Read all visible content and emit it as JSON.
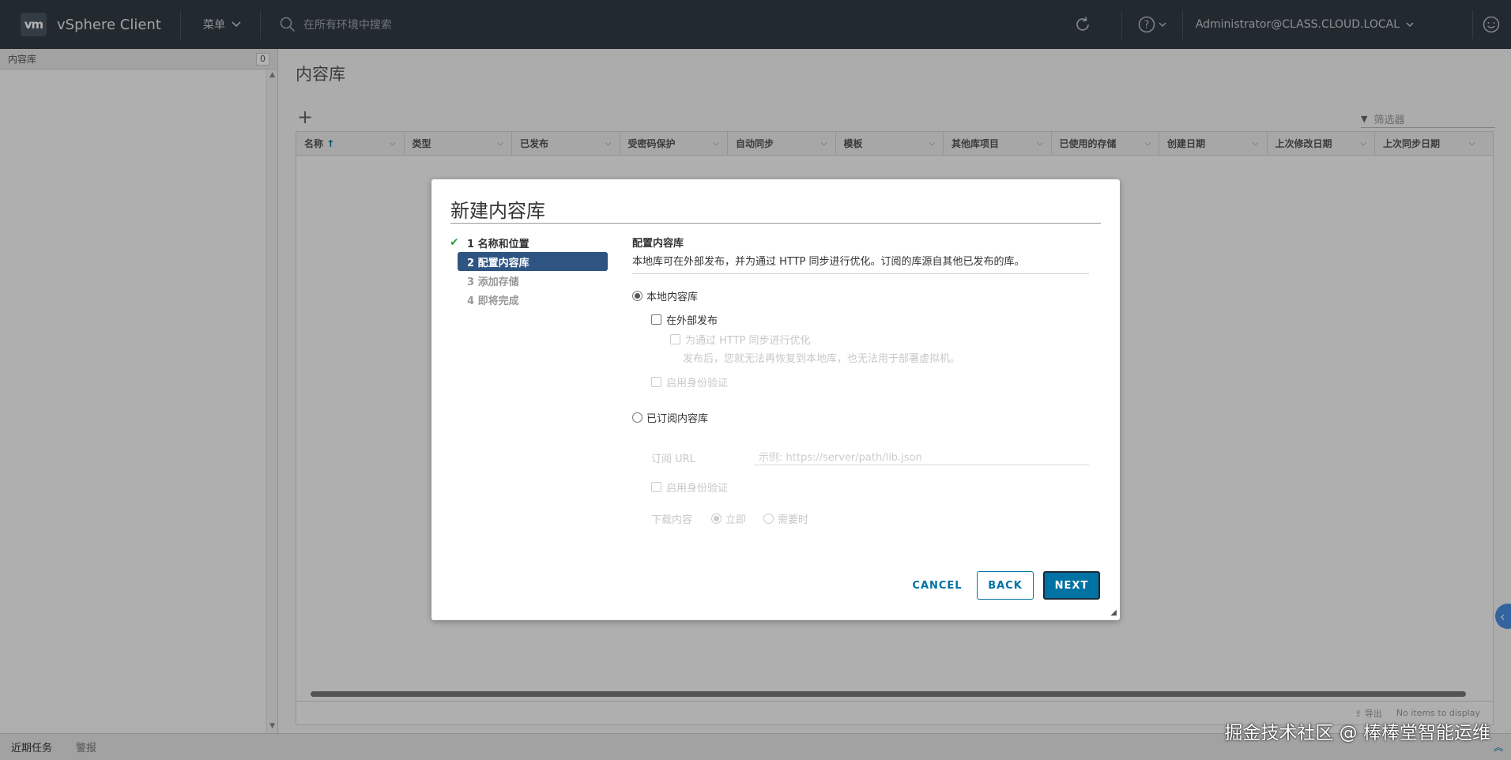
{
  "header": {
    "logo": "vm",
    "app_title": "vSphere Client",
    "menu_label": "菜单",
    "search_placeholder": "在所有环境中搜索",
    "user": "Administrator@CLASS.CLOUD.LOCAL",
    "icons": [
      "refresh-icon",
      "help-icon",
      "smiley-icon"
    ]
  },
  "left_pane": {
    "title": "内容库",
    "count": "0"
  },
  "main": {
    "title": "内容库",
    "add_label": "+",
    "filter_placeholder": "筛选器",
    "columns": [
      "名称",
      "类型",
      "已发布",
      "受密码保护",
      "自动同步",
      "模板",
      "其他库项目",
      "已使用的存储",
      "创建日期",
      "上次修改日期",
      "上次同步日期"
    ],
    "sort_indicator": "↑",
    "export_label": "导出",
    "empty_text": "No items to display"
  },
  "bottom": {
    "tab_recent": "近期任务",
    "tab_alarms": "警报"
  },
  "watermark": "掘金技术社区 @ 棒棒堂智能运维",
  "dialog": {
    "title": "新建内容库",
    "steps": [
      {
        "label": "1 名称和位置",
        "state": "done"
      },
      {
        "label": "2 配置内容库",
        "state": "active"
      },
      {
        "label": "3 添加存储",
        "state": "pending"
      },
      {
        "label": "4 即将完成",
        "state": "pending"
      }
    ],
    "section_title": "配置内容库",
    "section_desc": "本地库可在外部发布，并为通过 HTTP 同步进行优化。订阅的库源自其他已发布的库。",
    "local_library": "本地内容库",
    "publish_external": "在外部发布",
    "optimize_http": "为通过 HTTP 同步进行优化",
    "optimize_note": "发布后，您就无法再恢复到本地库，也无法用于部署虚拟机。",
    "enable_auth": "启用身份验证",
    "subscribed_library": "已订阅内容库",
    "subscription_url_label": "订阅 URL",
    "subscription_url_placeholder": "示例: https://server/path/lib.json",
    "enable_auth_sub": "启用身份验证",
    "download_label": "下载内容",
    "download_now": "立即",
    "download_when_needed": "需要时",
    "cancel": "CANCEL",
    "back": "BACK",
    "next": "NEXT"
  }
}
